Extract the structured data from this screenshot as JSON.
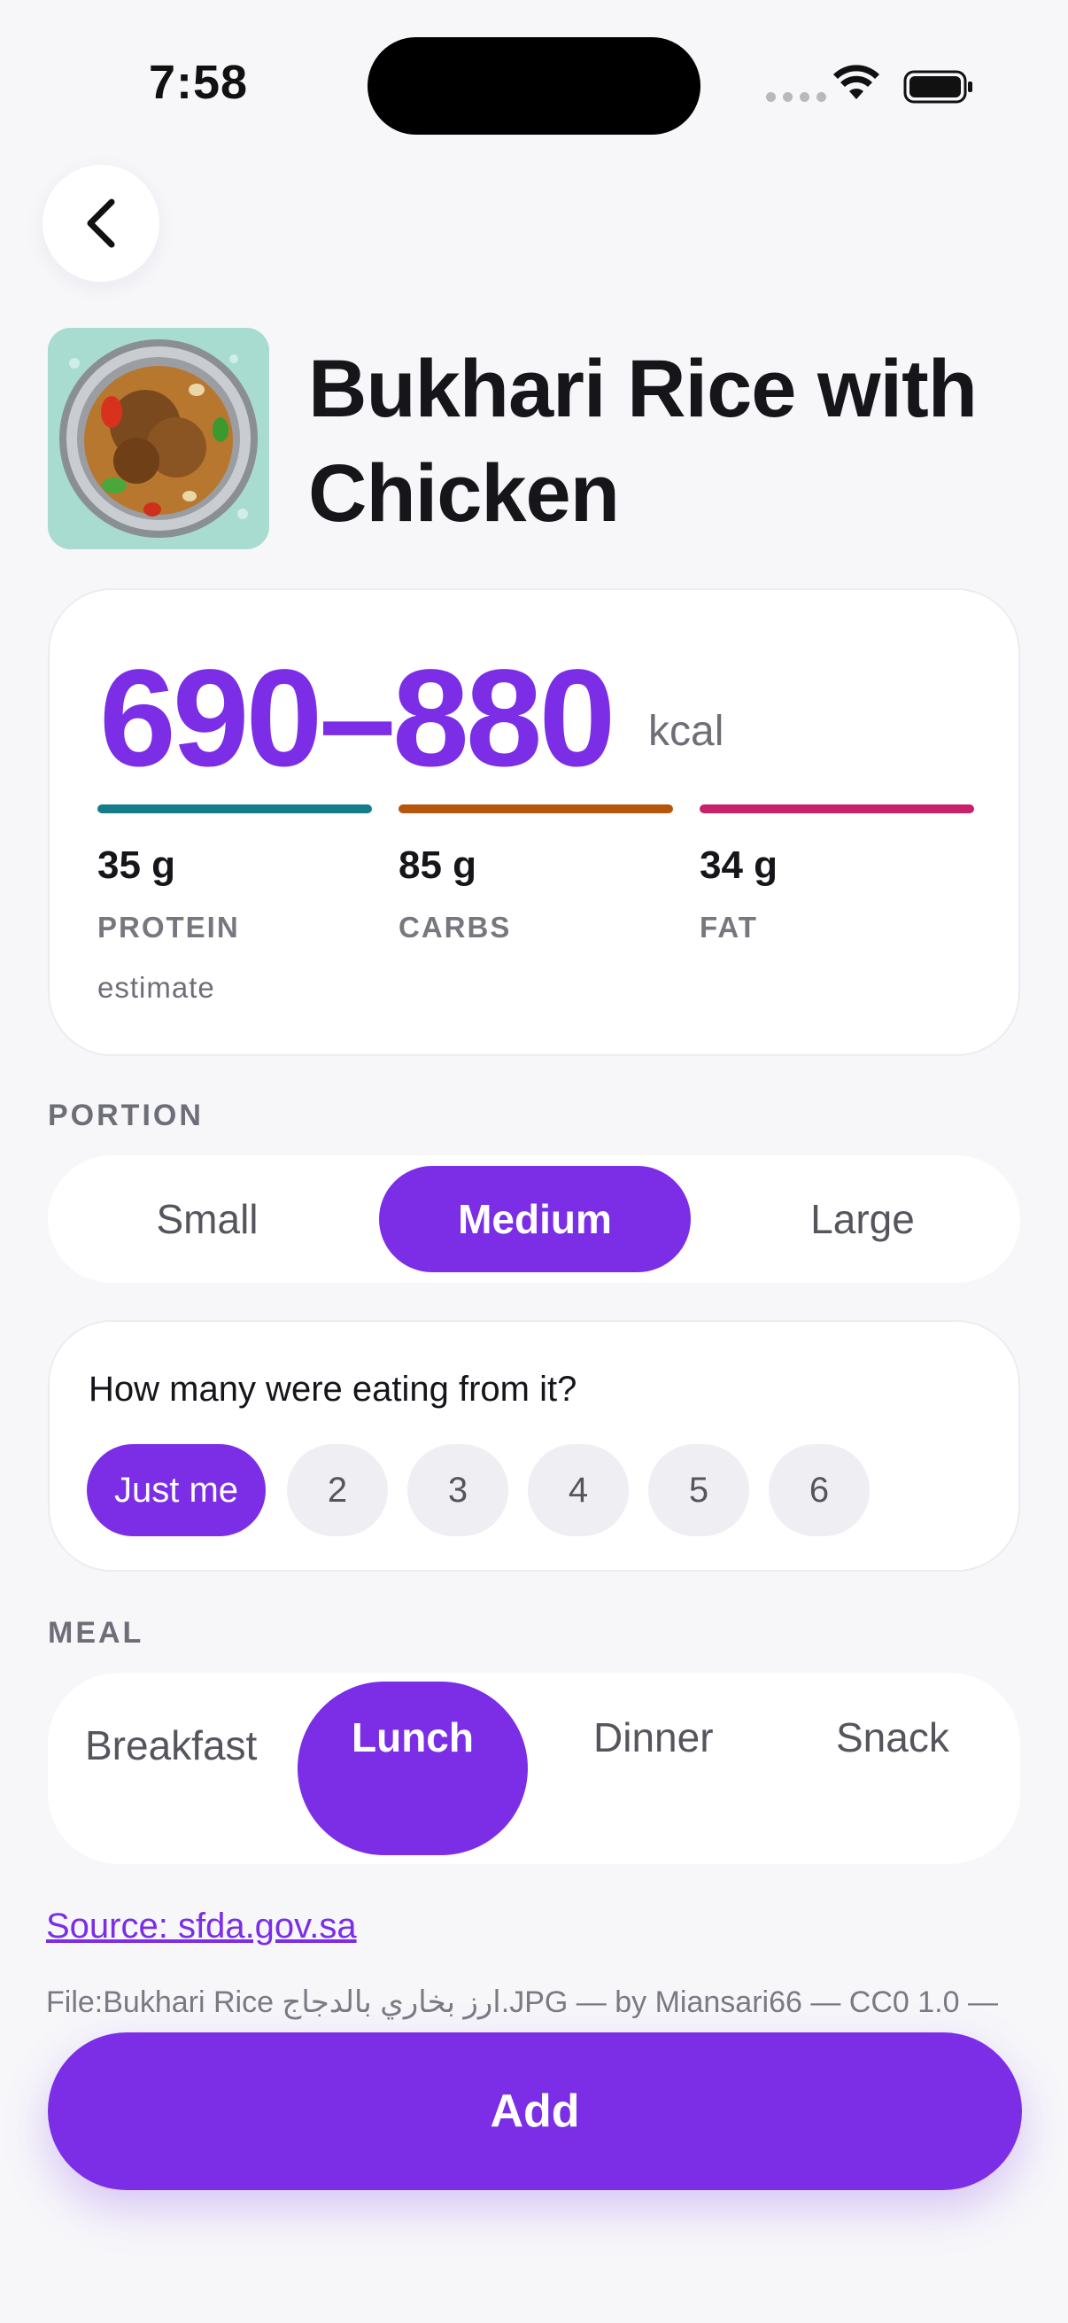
{
  "status_bar": {
    "time": "7:58"
  },
  "food": {
    "title": "Bukhari Rice with Chicken",
    "kcal_range": "690–880",
    "kcal_unit": "kcal",
    "estimate_note": "estimate"
  },
  "macros": [
    {
      "value": "35 g",
      "label": "PROTEIN",
      "color": "#177c8a"
    },
    {
      "value": "85 g",
      "label": "CARBS",
      "color": "#b5560c"
    },
    {
      "value": "34 g",
      "label": "FAT",
      "color": "#c8206b"
    }
  ],
  "portion": {
    "label": "PORTION",
    "options": [
      "Small",
      "Medium",
      "Large"
    ],
    "selected": "Medium"
  },
  "sharing": {
    "question": "How many were eating from it?",
    "options": [
      "Just me",
      "2",
      "3",
      "4",
      "5",
      "6"
    ],
    "selected": "Just me"
  },
  "meal": {
    "label": "MEAL",
    "options": [
      "Breakfast",
      "Lunch",
      "Dinner",
      "Snack"
    ],
    "selected": "Lunch"
  },
  "source": {
    "link_text": "Source: sfda.gov.sa"
  },
  "attribution": "File:Bukhari Rice ارز بخاري بالدجاج.JPG — by Miansari66 — CC0 1.0 —",
  "actions": {
    "add_label": "Add"
  },
  "colors": {
    "accent": "#7b2ee6",
    "background": "#f7f7fa"
  }
}
